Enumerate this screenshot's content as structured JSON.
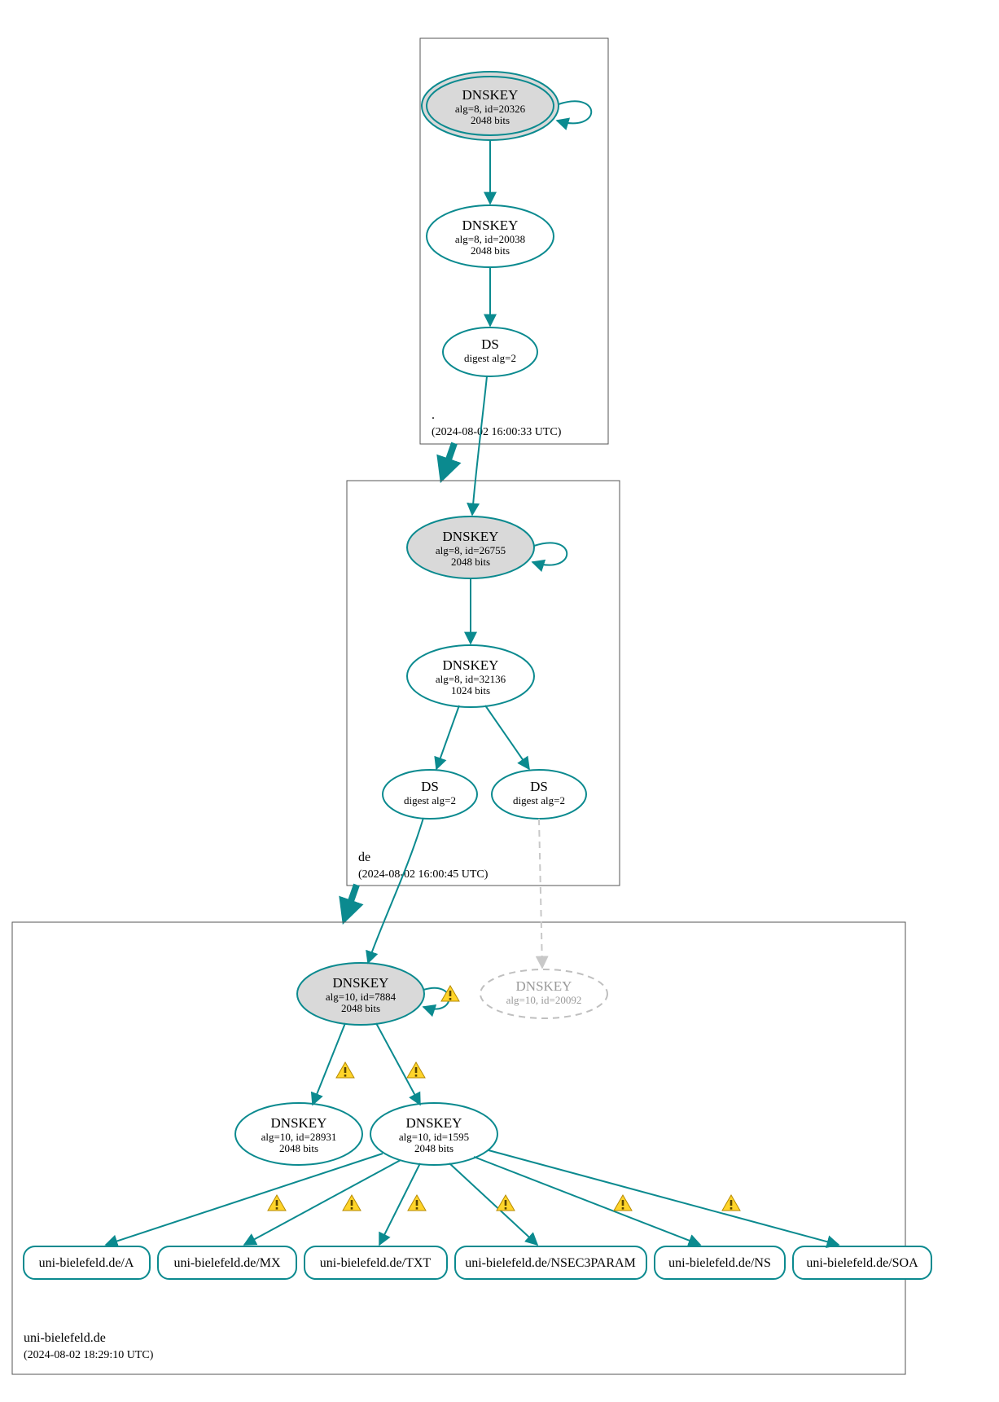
{
  "colors": {
    "accent": "#0b8a8f",
    "ghost": "#bfbfbf",
    "fill_grey": "#d9d9d9"
  },
  "icons": {
    "warning": "warning-triangle"
  },
  "zones": {
    "root": {
      "name": ".",
      "timestamp": "(2024-08-02 16:00:33 UTC)"
    },
    "de": {
      "name": "de",
      "timestamp": "(2024-08-02 16:00:45 UTC)"
    },
    "uni": {
      "name": "uni-bielefeld.de",
      "timestamp": "(2024-08-02 18:29:10 UTC)"
    }
  },
  "nodes": {
    "root_ksk": {
      "title": "DNSKEY",
      "line2": "alg=8, id=20326",
      "line3": "2048 bits"
    },
    "root_zsk": {
      "title": "DNSKEY",
      "line2": "alg=8, id=20038",
      "line3": "2048 bits"
    },
    "root_ds": {
      "title": "DS",
      "line2": "digest alg=2"
    },
    "de_ksk": {
      "title": "DNSKEY",
      "line2": "alg=8, id=26755",
      "line3": "2048 bits"
    },
    "de_zsk": {
      "title": "DNSKEY",
      "line2": "alg=8, id=32136",
      "line3": "1024 bits"
    },
    "de_ds1": {
      "title": "DS",
      "line2": "digest alg=2"
    },
    "de_ds2": {
      "title": "DS",
      "line2": "digest alg=2"
    },
    "uni_ksk": {
      "title": "DNSKEY",
      "line2": "alg=10, id=7884",
      "line3": "2048 bits"
    },
    "uni_ghost": {
      "title": "DNSKEY",
      "line2": "alg=10, id=20092"
    },
    "uni_zsk1": {
      "title": "DNSKEY",
      "line2": "alg=10, id=28931",
      "line3": "2048 bits"
    },
    "uni_zsk2": {
      "title": "DNSKEY",
      "line2": "alg=10, id=1595",
      "line3": "2048 bits"
    }
  },
  "rrsets": {
    "a": "uni-bielefeld.de/A",
    "mx": "uni-bielefeld.de/MX",
    "txt": "uni-bielefeld.de/TXT",
    "n3p": "uni-bielefeld.de/NSEC3PARAM",
    "ns": "uni-bielefeld.de/NS",
    "soa": "uni-bielefeld.de/SOA"
  }
}
